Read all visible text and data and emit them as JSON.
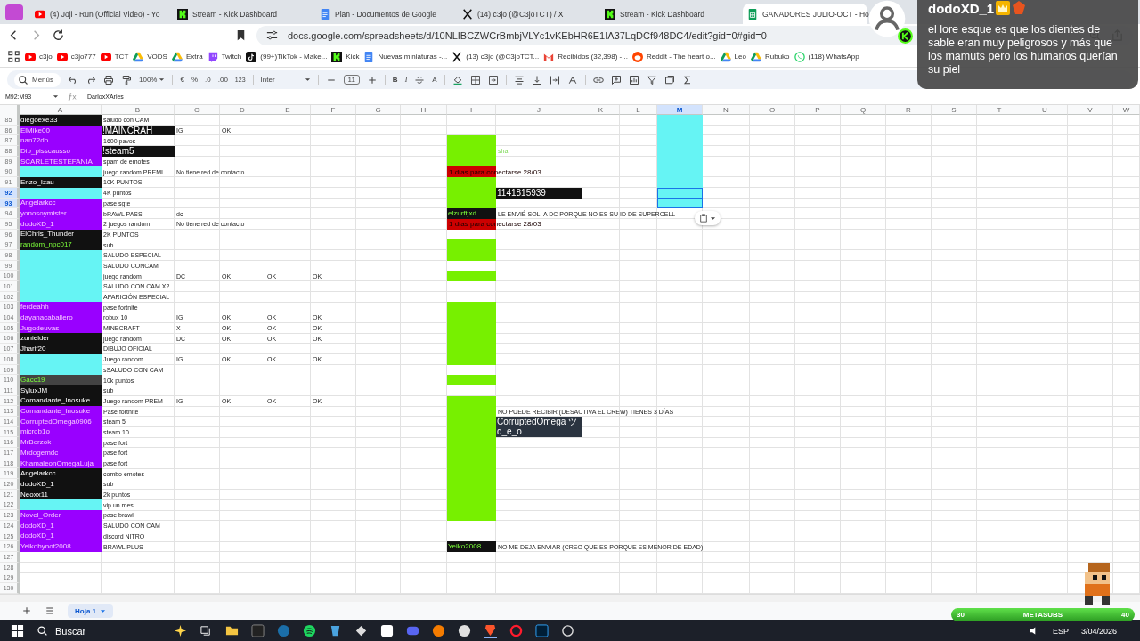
{
  "tabs": [
    {
      "kind": "video",
      "title": "(4) Joji - Run (Official Video) - Yo",
      "selected": false
    },
    {
      "kind": "kick",
      "title": "Stream - Kick Dashboard",
      "selected": false
    },
    {
      "kind": "docs",
      "title": "Plan - Documentos de Google",
      "selected": false
    },
    {
      "kind": "x",
      "title": "(14) c3jo (@C3joTCT) / X",
      "selected": false
    },
    {
      "kind": "kick",
      "title": "Stream - Kick Dashboard",
      "selected": false
    },
    {
      "kind": "sheets",
      "title": "GANADORES JULIO-OCT - Ho",
      "selected": true
    }
  ],
  "address": "docs.google.com/spreadsheets/d/10NLIBCZWCrBmbjVLYc1vKEbHR6E1IA37LqDCf948DC4/edit?gid=0#gid=0",
  "bookmarks": [
    {
      "kind": "video",
      "label": "c3jo"
    },
    {
      "kind": "video",
      "label": "c3jo777"
    },
    {
      "kind": "video",
      "label": "TCT"
    },
    {
      "kind": "drive",
      "label": "VODS"
    },
    {
      "kind": "drive",
      "label": "Extra"
    },
    {
      "kind": "twitch",
      "label": "Twitch"
    },
    {
      "kind": "tiktok",
      "label": "(99+)TikTok - Make..."
    },
    {
      "kind": "kick",
      "label": "Kick"
    },
    {
      "kind": "docs",
      "label": "Nuevas miniaturas -..."
    },
    {
      "kind": "x",
      "label": "(13) c3jo (@C3joTCT..."
    },
    {
      "kind": "mail",
      "label": "Recibidos (32,398) -..."
    },
    {
      "kind": "reddit",
      "label": "Reddit - The heart o..."
    },
    {
      "kind": "drive",
      "label": "Leo"
    },
    {
      "kind": "drive",
      "label": "Rubuko"
    },
    {
      "kind": "whatsapp",
      "label": "(118) WhatsApp"
    }
  ],
  "toolbar": {
    "search": "Menús",
    "zoom": "100%",
    "currency": "€",
    "percent": "%",
    "decrease_decimals": ".0",
    "increase_decimals": ".00",
    "number_format": "123",
    "font": "Inter",
    "font_size": "11",
    "bold": "B",
    "italic": "I",
    "font_color": "A"
  },
  "formula_bar": {
    "cell_reference": "M92:M93",
    "value": "DarloxXAries"
  },
  "columns": [
    {
      "label": "A",
      "selected": false
    },
    {
      "label": "B",
      "selected": false
    },
    {
      "label": "C",
      "selected": false
    },
    {
      "label": "D",
      "selected": false
    },
    {
      "label": "E",
      "selected": false
    },
    {
      "label": "F",
      "selected": false
    },
    {
      "label": "G",
      "selected": false
    },
    {
      "label": "H",
      "selected": false
    },
    {
      "label": "I",
      "selected": false
    },
    {
      "label": "J",
      "selected": false
    },
    {
      "label": "K",
      "selected": false
    },
    {
      "label": "L",
      "selected": false
    },
    {
      "label": "M",
      "selected": true
    },
    {
      "label": "N",
      "selected": false
    },
    {
      "label": "O",
      "selected": false
    },
    {
      "label": "P",
      "selected": false
    },
    {
      "label": "Q",
      "selected": false
    },
    {
      "label": "R",
      "selected": false
    },
    {
      "label": "S",
      "selected": false
    },
    {
      "label": "T",
      "selected": false
    },
    {
      "label": "U",
      "selected": false
    },
    {
      "label": "V",
      "selected": false
    },
    {
      "label": "W",
      "selected": false
    }
  ],
  "rows": [
    {
      "number": "85",
      "selected": false,
      "a": {
        "text": "diegoexe33",
        "color": "#111111",
        "kind": "inverse"
      },
      "b": {
        "text": "saludo con CAM"
      },
      "m": {
        "color": "#66f4f4"
      }
    },
    {
      "number": "86",
      "selected": false,
      "a": {
        "text": "ElMike00",
        "color": "#9900ff",
        "kind": "name"
      },
      "b": {
        "text": "!MAINCRAH",
        "color": "#111111",
        "kind": "inverse"
      },
      "c": {
        "text": "IG"
      },
      "d": {
        "text": "OK"
      },
      "m": {
        "color": "#66f4f4"
      }
    },
    {
      "number": "87",
      "selected": false,
      "a": {
        "text": "nan72do",
        "color": "#9900ff",
        "kind": "name"
      },
      "b": {
        "text": "1600 pavos"
      },
      "i": {
        "color": "#77f000"
      },
      "m": {
        "color": "#66f4f4"
      }
    },
    {
      "number": "88",
      "selected": false,
      "a": {
        "text": "Dip_pisscausso",
        "color": "#9900ff",
        "kind": "name"
      },
      "b": {
        "text": "!steam5",
        "color": "#111111",
        "kind": "inverse"
      },
      "i": {
        "color": "#77f000"
      },
      "j": {
        "text": "sha",
        "kind": "hint"
      },
      "m": {
        "color": "#66f4f4"
      }
    },
    {
      "number": "89",
      "selected": false,
      "a": {
        "text": "SCARLETESTEFANIA",
        "color": "#9900ff",
        "kind": "name"
      },
      "b": {
        "text": "spam de emotes"
      },
      "i": {
        "color": "#77f000"
      },
      "m": {
        "color": "#66f4f4"
      }
    },
    {
      "number": "90",
      "selected": false,
      "a": {
        "color": "#66f4f4"
      },
      "b": {
        "text": "juego random PREMI"
      },
      "c": {
        "text": "No tiene red de contacto"
      },
      "i": {
        "text": "1 días para conectarse 28/03",
        "color": "#cc0000",
        "kind": "warning"
      },
      "m": {
        "color": "#66f4f4"
      }
    },
    {
      "number": "91",
      "selected": false,
      "a": {
        "text": "Enzo_Izau",
        "color": "#111111",
        "kind": "inverse"
      },
      "b": {
        "text": "10K PUNTOS"
      },
      "i": {
        "color": "#77f000"
      },
      "m": {
        "color": "#66f4f4"
      }
    },
    {
      "number": "92",
      "selected": true,
      "a": {
        "color": "#66f4f4"
      },
      "b": {
        "text": "4K puntos"
      },
      "i": {
        "color": "#77f000"
      },
      "j": {
        "text": "1141815939",
        "color": "#111111",
        "kind": "inverse"
      },
      "m": {
        "color": "#66f4f4"
      }
    },
    {
      "number": "93",
      "selected": true,
      "a": {
        "text": "Angelarkcc",
        "color": "#9900ff",
        "kind": "name"
      },
      "b": {
        "text": "pase sgte"
      },
      "i": {
        "color": "#77f000"
      },
      "m": {
        "color": "#66f4f4"
      }
    },
    {
      "number": "94",
      "selected": false,
      "a": {
        "text": "yonosoymister",
        "color": "#9900ff",
        "kind": "name"
      },
      "b": {
        "text": "bRAWL PASS"
      },
      "c": {
        "text": "dc"
      },
      "i": {
        "text": "elzurftjxd",
        "color": "#111111",
        "kind": "highlight"
      },
      "j": {
        "text": "LE ENVIÉ SOLI A DC PORQUE NO ES SU ID DE SUPERCELL"
      }
    },
    {
      "number": "95",
      "selected": false,
      "a": {
        "text": "dodoXD_1",
        "color": "#9900ff",
        "kind": "name"
      },
      "b": {
        "text": "2 juegos random"
      },
      "c": {
        "text": "No tiene red de contacto"
      },
      "i": {
        "text": "1 días para conectarse 28/03",
        "color": "#cc0000",
        "kind": "warning"
      }
    },
    {
      "number": "96",
      "selected": false,
      "a": {
        "text": "ElChris_Thunder",
        "color": "#111111",
        "kind": "inverse"
      },
      "b": {
        "text": "2K PUNTOS"
      }
    },
    {
      "number": "97",
      "selected": false,
      "a": {
        "text": "random_npc017",
        "color": "#111111",
        "kind": "highlight"
      },
      "b": {
        "text": "sub"
      },
      "i": {
        "color": "#77f000"
      }
    },
    {
      "number": "98",
      "selected": false,
      "a": {
        "color": "#66f4f4"
      },
      "b": {
        "text": "SALUDO ESPECIAL"
      },
      "i": {
        "color": "#77f000"
      }
    },
    {
      "number": "99",
      "selected": false,
      "a": {
        "color": "#66f4f4"
      },
      "b": {
        "text": "SALUDO CONCAM"
      }
    },
    {
      "number": "100",
      "selected": false,
      "a": {
        "color": "#66f4f4"
      },
      "b": {
        "text": "juego random"
      },
      "c": {
        "text": "DC"
      },
      "d": {
        "text": "OK"
      },
      "e": {
        "text": "OK"
      },
      "f": {
        "text": "OK"
      },
      "i": {
        "color": "#77f000"
      }
    },
    {
      "number": "101",
      "selected": false,
      "a": {
        "color": "#66f4f4"
      },
      "b": {
        "text": "SALUDO CON CAM X2"
      }
    },
    {
      "number": "102",
      "selected": false,
      "a": {
        "color": "#66f4f4"
      },
      "b": {
        "text": "APARICIÓN ESPECIAL"
      }
    },
    {
      "number": "103",
      "selected": false,
      "a": {
        "text": "ferdeahh",
        "color": "#9900ff",
        "kind": "name"
      },
      "b": {
        "text": "pase fortnite"
      },
      "i": {
        "color": "#77f000"
      }
    },
    {
      "number": "104",
      "selected": false,
      "a": {
        "text": "dayanacaballero",
        "color": "#9900ff",
        "kind": "name"
      },
      "b": {
        "text": "robux 10"
      },
      "c": {
        "text": "IG"
      },
      "d": {
        "text": "OK"
      },
      "e": {
        "text": "OK"
      },
      "f": {
        "text": "OK"
      },
      "i": {
        "color": "#77f000"
      }
    },
    {
      "number": "105",
      "selected": false,
      "a": {
        "text": "Jugodeuvas",
        "color": "#9900ff",
        "kind": "name"
      },
      "b": {
        "text": "MINECRAFT"
      },
      "c": {
        "text": "X"
      },
      "d": {
        "text": "OK"
      },
      "e": {
        "text": "OK"
      },
      "f": {
        "text": "OK"
      },
      "i": {
        "color": "#77f000"
      }
    },
    {
      "number": "106",
      "selected": false,
      "a": {
        "text": "zunielder",
        "color": "#111111",
        "kind": "inverse"
      },
      "b": {
        "text": "juego random"
      },
      "c": {
        "text": "DC"
      },
      "d": {
        "text": "OK"
      },
      "e": {
        "text": "OK"
      },
      "f": {
        "text": "OK"
      },
      "i": {
        "color": "#77f000"
      }
    },
    {
      "number": "107",
      "selected": false,
      "a": {
        "text": "Jharif20",
        "color": "#111111",
        "kind": "inverse"
      },
      "b": {
        "text": "DIBUJO OFICIAL"
      },
      "i": {
        "color": "#77f000"
      }
    },
    {
      "number": "108",
      "selected": false,
      "a": {
        "color": "#66f4f4"
      },
      "b": {
        "text": "Juego random"
      },
      "c": {
        "text": "IG"
      },
      "d": {
        "text": "OK"
      },
      "e": {
        "text": "OK"
      },
      "f": {
        "text": "OK"
      },
      "i": {
        "color": "#77f000"
      }
    },
    {
      "number": "109",
      "selected": false,
      "a": {
        "color": "#66f4f4"
      },
      "b": {
        "text": "sSALUDO CON CAM"
      }
    },
    {
      "number": "110",
      "selected": false,
      "a": {
        "text": "Gacc19",
        "color": "#434343",
        "kind": "highlight"
      },
      "b": {
        "text": "10k puntos"
      },
      "i": {
        "color": "#77f000"
      }
    },
    {
      "number": "111",
      "selected": false,
      "a": {
        "text": "SyluxJM",
        "color": "#111111",
        "kind": "inverse"
      },
      "b": {
        "text": "sub"
      }
    },
    {
      "number": "112",
      "selected": false,
      "a": {
        "text": "Comandante_Inosuke",
        "color": "#111111",
        "kind": "inverse"
      },
      "b": {
        "text": "Juego random PREM"
      },
      "c": {
        "text": "IG"
      },
      "d": {
        "text": "OK"
      },
      "e": {
        "text": "OK"
      },
      "f": {
        "text": "OK"
      },
      "i": {
        "color": "#77f000"
      }
    },
    {
      "number": "113",
      "selected": false,
      "a": {
        "text": "Comandante_Inosuke",
        "color": "#9900ff",
        "kind": "name"
      },
      "b": {
        "text": "Pase fortnite"
      },
      "i": {
        "color": "#77f000"
      },
      "j": {
        "text": "NO PUEDE RECIBIR (DESACTIVA EL CREW) TIENES 3 DÍAS"
      }
    },
    {
      "number": "114",
      "selected": false,
      "a": {
        "text": "CorruptedOmega0906",
        "color": "#9900ff",
        "kind": "name"
      },
      "b": {
        "text": "steam 5"
      },
      "i": {
        "color": "#77f000"
      },
      "j": {
        "text": "CorruptedOmega ツ",
        "color": "#2b3440",
        "kind": "inverse"
      }
    },
    {
      "number": "115",
      "selected": false,
      "a": {
        "text": "microb1o",
        "color": "#9900ff",
        "kind": "name"
      },
      "b": {
        "text": "steam 10"
      },
      "i": {
        "color": "#77f000"
      },
      "j": {
        "text": "d_e_o",
        "color": "#2b3440",
        "kind": "inverse"
      }
    },
    {
      "number": "116",
      "selected": false,
      "a": {
        "text": "MrBorzok",
        "color": "#9900ff",
        "kind": "name"
      },
      "b": {
        "text": "pase fort"
      },
      "i": {
        "color": "#77f000"
      }
    },
    {
      "number": "117",
      "selected": false,
      "a": {
        "text": "Mrdogemdc",
        "color": "#9900ff",
        "kind": "name"
      },
      "b": {
        "text": "pase fort"
      },
      "i": {
        "color": "#77f000"
      }
    },
    {
      "number": "118",
      "selected": false,
      "a": {
        "text": "KhamaleonOmegaLuja",
        "color": "#9900ff",
        "kind": "name"
      },
      "b": {
        "text": "pase fort"
      },
      "i": {
        "color": "#77f000"
      }
    },
    {
      "number": "119",
      "selected": false,
      "a": {
        "text": "Angelarkcc",
        "color": "#111111",
        "kind": "inverse"
      },
      "b": {
        "text": "combo emotes"
      },
      "i": {
        "color": "#77f000"
      }
    },
    {
      "number": "120",
      "selected": false,
      "a": {
        "text": "dodoXD_1",
        "color": "#111111",
        "kind": "inverse"
      },
      "b": {
        "text": "sub"
      },
      "i": {
        "color": "#77f000"
      }
    },
    {
      "number": "121",
      "selected": false,
      "a": {
        "text": "Neoxx11",
        "color": "#111111",
        "kind": "inverse"
      },
      "b": {
        "text": "2k puntos"
      },
      "i": {
        "color": "#77f000"
      }
    },
    {
      "number": "122",
      "selected": false,
      "a": {
        "color": "#66f4f4"
      },
      "b": {
        "text": "vip un mes"
      },
      "i": {
        "color": "#77f000"
      }
    },
    {
      "number": "123",
      "selected": false,
      "a": {
        "text": "Novel_Order",
        "color": "#9900ff",
        "kind": "name"
      },
      "b": {
        "text": "pase brawl"
      },
      "i": {
        "color": "#77f000"
      }
    },
    {
      "number": "124",
      "selected": false,
      "a": {
        "text": "dodoXD_1",
        "color": "#9900ff",
        "kind": "name"
      },
      "b": {
        "text": "SALUDO CON CAM"
      }
    },
    {
      "number": "125",
      "selected": false,
      "a": {
        "text": "dodoXD_1",
        "color": "#9900ff",
        "kind": "name"
      },
      "b": {
        "text": "discord NITRO"
      }
    },
    {
      "number": "126",
      "selected": false,
      "a": {
        "text": "Yeikobynot2008",
        "color": "#9900ff",
        "kind": "name"
      },
      "b": {
        "text": "BRAWL PLUS"
      },
      "i": {
        "text": "Yeiko2008",
        "color": "#111111",
        "kind": "highlight"
      },
      "j": {
        "text": "NO ME DEJA ENVIAR (CREO QUE ES PORQUE ES MENOR DE EDAD)"
      }
    },
    {
      "number": "127",
      "selected": false
    },
    {
      "number": "128",
      "selected": false
    },
    {
      "number": "129",
      "selected": false
    },
    {
      "number": "130",
      "selected": false
    }
  ],
  "sheet_tabs": [
    {
      "label": "Hoja 1",
      "selected": true
    }
  ],
  "taskbar": {
    "search": "Buscar",
    "language": "ESP",
    "date": "3/04/2026"
  },
  "chat_overlay": {
    "user": "dodoXD_1",
    "message": "el lore esque es que los dientes de sable eran muy peligrosos y más que los mamuts pero los humanos querían su piel"
  },
  "goal_bar": {
    "current": "30",
    "label": "METASUBS",
    "target": "40"
  }
}
